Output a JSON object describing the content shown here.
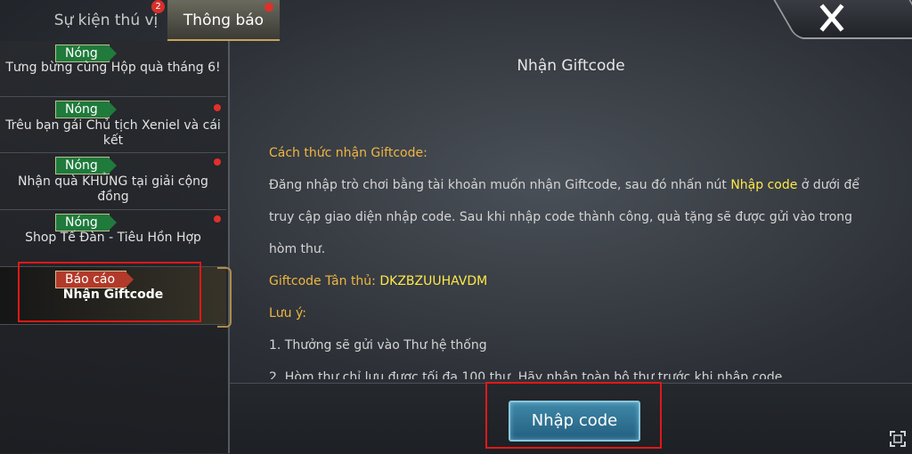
{
  "tabs": {
    "events": {
      "label": "Sự kiện thú vị",
      "badge": "2"
    },
    "notices": {
      "label": "Thông báo"
    }
  },
  "sidebar": {
    "items": [
      {
        "tag": "Nóng",
        "title": "Tưng bừng cùng Hộp quà tháng 6!",
        "unread": false
      },
      {
        "tag": "Nóng",
        "title": "Trêu bạn gái Chủ tịch Xeniel và cái kết",
        "unread": true
      },
      {
        "tag": "Nóng",
        "title": "Nhận quà KHỦNG tại giải cộng đồng",
        "unread": true
      },
      {
        "tag": "Nóng",
        "title": "Shop Tế Đàn - Tiêu Hồn Hợp",
        "unread": true
      },
      {
        "tag": "Báo cáo",
        "title": "Nhận Giftcode",
        "unread": false,
        "selected": true
      }
    ]
  },
  "content": {
    "title": "Nhận Giftcode",
    "how_to_heading": "Cách thức nhận Giftcode:",
    "para_before": "Đăng nhập trò chơi bằng tài khoản muốn nhận Giftcode, sau đó nhấn nút ",
    "para_highlight": "Nhập code",
    "para_after": " ở dưới để",
    "para_line2": "truy cập giao diện nhập code. Sau khi nhập code thành công, quà tặng sẽ được gửi vào trong",
    "para_line3": "hòm thư.",
    "giftcode_label": "Giftcode Tân thủ: ",
    "giftcode_value": "DKZBZUUHAVDM",
    "note_heading": "Lưu ý:",
    "note_1": "1. Thưởng sẽ gửi vào Thư hệ thống",
    "note_2": "2. Hòm thư chỉ lưu được tối đa 100 thư. Hãy nhận toàn bộ thư trước khi nhập code"
  },
  "actions": {
    "enter_code_label": "Nhập code"
  },
  "icons": {
    "close": "close-icon",
    "expand": "expand-icon"
  },
  "colors": {
    "accent_gold": "#f0b640",
    "highlight_yellow": "#ffe94a",
    "button_blue": "#2f7898",
    "hot_tag": "#1f7a3c",
    "report_tag": "#b23a2a",
    "annotation_red": "#e01818"
  }
}
